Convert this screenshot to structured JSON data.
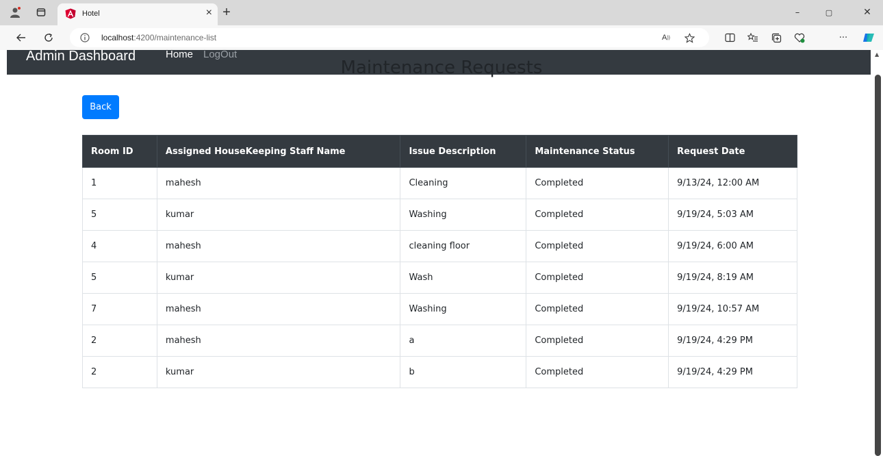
{
  "browser": {
    "tab_title": "Hotel",
    "tab_close": "×",
    "new_tab": "+",
    "url_host": "localhost",
    "url_path": ":4200/maintenance-list",
    "window_controls": [
      "–",
      "▢",
      "✕"
    ]
  },
  "navbar": {
    "brand": "Admin Dashboard",
    "home": "Home",
    "logout": "LogOut"
  },
  "page": {
    "title": "Maintenance Requests",
    "back_label": "Back"
  },
  "table": {
    "headers": [
      "Room ID",
      "Assigned HouseKeeping Staff Name",
      "Issue Description",
      "Maintenance Status",
      "Request Date"
    ],
    "rows": [
      [
        "1",
        "mahesh",
        "Cleaning",
        "Completed",
        "9/13/24, 12:00 AM"
      ],
      [
        "5",
        "kumar",
        "Washing",
        "Completed",
        "9/19/24, 5:03 AM"
      ],
      [
        "4",
        "mahesh",
        "cleaning floor",
        "Completed",
        "9/19/24, 6:00 AM"
      ],
      [
        "5",
        "kumar",
        "Wash",
        "Completed",
        "9/19/24, 8:19 AM"
      ],
      [
        "7",
        "mahesh",
        "Washing",
        "Completed",
        "9/19/24, 10:57 AM"
      ],
      [
        "2",
        "mahesh",
        "a",
        "Completed",
        "9/19/24, 4:29 PM"
      ],
      [
        "2",
        "kumar",
        "b",
        "Completed",
        "9/19/24, 4:29 PM"
      ]
    ]
  },
  "colors": {
    "navbar_bg": "#343a40",
    "primary": "#007bff",
    "table_header_bg": "#343a40"
  }
}
